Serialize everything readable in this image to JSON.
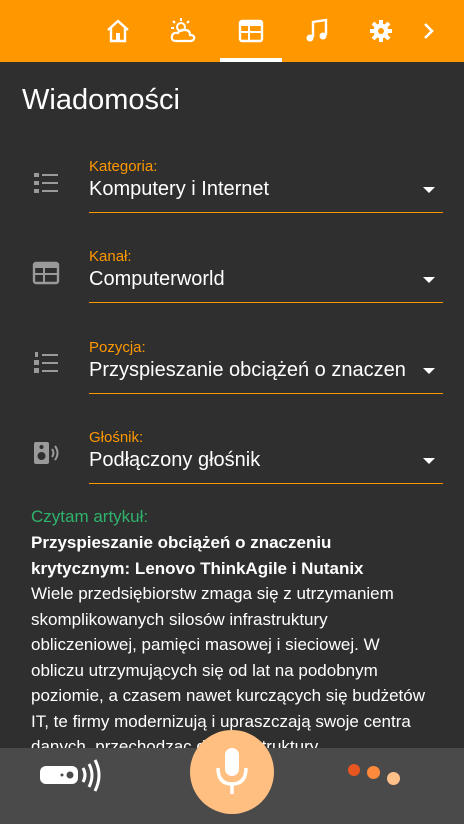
{
  "nav": {
    "tabs": [
      {
        "name": "home-icon",
        "active": false
      },
      {
        "name": "weather-icon",
        "active": false
      },
      {
        "name": "calendar-icon",
        "active": true
      },
      {
        "name": "music-icon",
        "active": false
      },
      {
        "name": "gear-icon",
        "active": false
      },
      {
        "name": "chevron-right-icon",
        "active": false
      }
    ],
    "accent_color": "#ff9800"
  },
  "page": {
    "title": "Wiadomości"
  },
  "fields": {
    "category": {
      "label": "Kategoria:",
      "value": "Komputery i Internet",
      "icon": "category-list-icon"
    },
    "channel": {
      "label": "Kanał:",
      "value": "Computerworld",
      "icon": "channel-newspaper-icon"
    },
    "position": {
      "label": "Pozycja:",
      "value": "Przyspieszanie obciążeń o znaczeniu krytycznym: Lenovo ThinkAgile i Nutanix",
      "icon": "numbered-list-icon"
    },
    "speaker": {
      "label": "Głośnik:",
      "value": "Podłączony głośnik",
      "icon": "speaker-icon"
    }
  },
  "reading": {
    "label": "Czytam artykuł:",
    "title": "Przyspieszanie obciążeń o znaczeniu krytycznym: Lenovo ThinkAgile i Nutanix",
    "body": "Wiele przedsiębiorstw zmaga się z utrzymaniem skomplikowanych silosów infrastruktury obliczeniowej, pamięci masowej i sieciowej. W obliczu utrzymujących się od lat na podobnym poziomie, a czasem nawet kurczących się budżetów IT, te firmy modernizują i upraszczają swoje centra danych, przechodząc do infrastruktury",
    "label_color": "#2fb36c"
  },
  "bottom": {
    "speaker_button": "wireless-speaker-icon",
    "mic_button": "microphone-icon",
    "menu_button": "dots-icon",
    "mic_color": "#ffbf80"
  }
}
